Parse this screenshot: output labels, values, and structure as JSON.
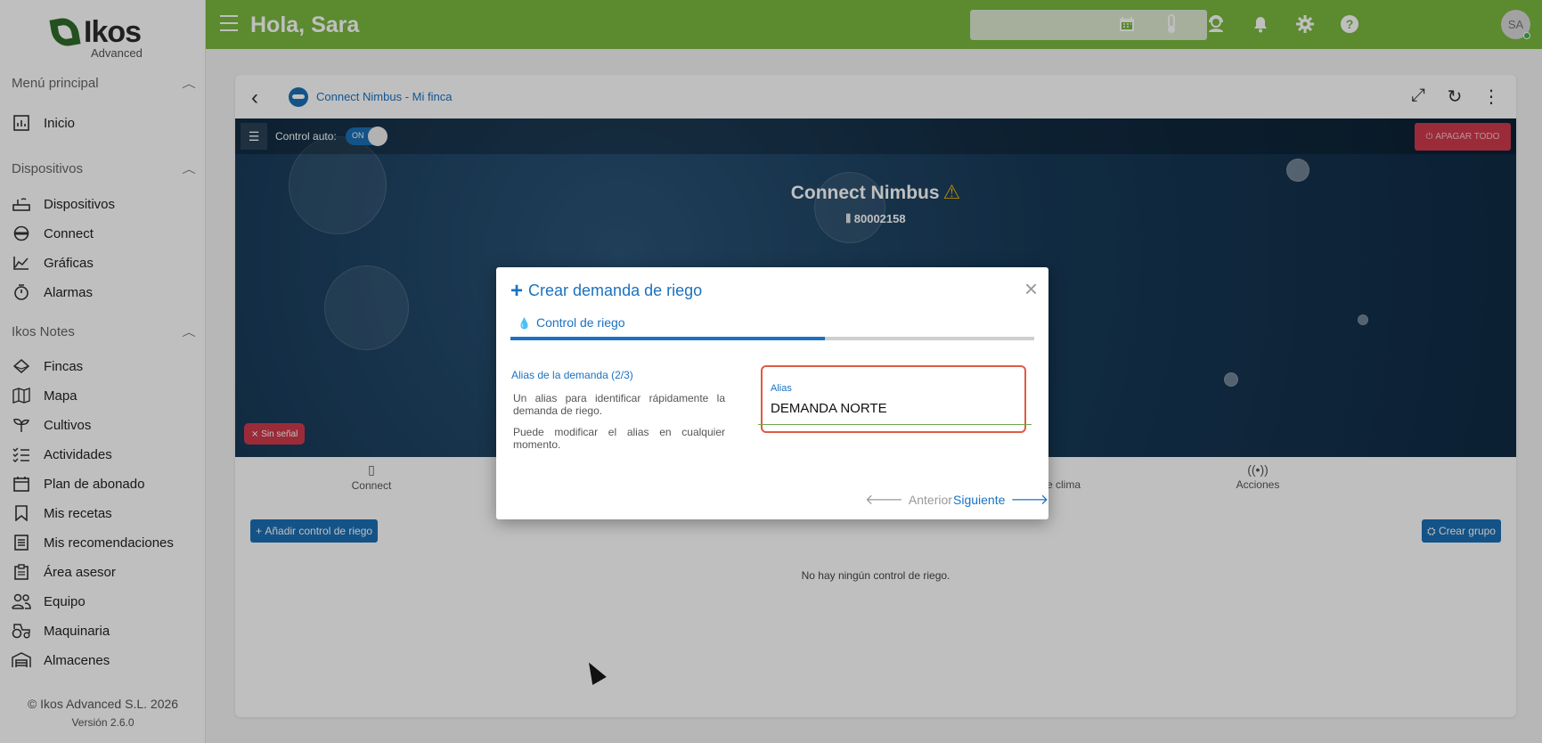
{
  "app": {
    "logo_text": "Ikos",
    "logo_sub": "Advanced",
    "greeting": "Hola, Sara",
    "avatar_initials": "SA",
    "accent_color": "#7ab83f",
    "brand_blue": "#1b72c0"
  },
  "sidebar": {
    "sections": [
      {
        "title": "Menú principal",
        "items": [
          {
            "label": "Inicio",
            "icon": "chart-icon"
          }
        ]
      },
      {
        "title": "Dispositivos",
        "items": [
          {
            "label": "Dispositivos",
            "icon": "router-icon"
          },
          {
            "label": "Connect",
            "icon": "connect-icon"
          },
          {
            "label": "Gráficas",
            "icon": "area-chart-icon"
          },
          {
            "label": "Alarmas",
            "icon": "stopwatch-icon"
          }
        ]
      },
      {
        "title": "Ikos Notes",
        "items": [
          {
            "label": "Fincas",
            "icon": "layers-icon"
          },
          {
            "label": "Mapa",
            "icon": "map-icon"
          },
          {
            "label": "Cultivos",
            "icon": "sprout-icon"
          },
          {
            "label": "Actividades",
            "icon": "checklist-icon"
          },
          {
            "label": "Plan de abonado",
            "icon": "calendar-icon"
          },
          {
            "label": "Mis recetas",
            "icon": "bookmark-icon"
          },
          {
            "label": "Mis recomendaciones",
            "icon": "list-icon"
          },
          {
            "label": "Área asesor",
            "icon": "clipboard-icon"
          },
          {
            "label": "Equipo",
            "icon": "team-icon"
          },
          {
            "label": "Maquinaria",
            "icon": "tractor-icon"
          },
          {
            "label": "Almacenes",
            "icon": "warehouse-icon"
          }
        ]
      }
    ],
    "footer_copyright": "© Ikos Advanced S.L. 2026",
    "footer_version": "Versión 2.6.0"
  },
  "card": {
    "breadcrumb": "Connect Nimbus - Mi finca",
    "control_auto_label": "Control auto:",
    "toggle_state": "ON",
    "apagar_label": "APAGAR TODO",
    "device_title": "Connect Nimbus",
    "serial": "80002158",
    "sin_senal": "Sin señal",
    "tabs": [
      "Connect",
      "e clima",
      "Acciones"
    ],
    "add_button": "Añadir control de riego",
    "group_button": "Crear grupo",
    "empty_message": "No hay ningún control de riego."
  },
  "modal": {
    "title": "Crear demanda de riego",
    "step_label": "Control de riego",
    "progress_fraction": 0.6,
    "section_title": "Alias de la demanda (2/3)",
    "desc1": "Un alias para identificar rápidamente la demanda de riego.",
    "desc2": "Puede modificar el alias en cualquier momento.",
    "alias_label": "Alias",
    "alias_value": "DEMANDA NORTE",
    "prev_label": "Anterior",
    "next_label": "Siguiente"
  }
}
